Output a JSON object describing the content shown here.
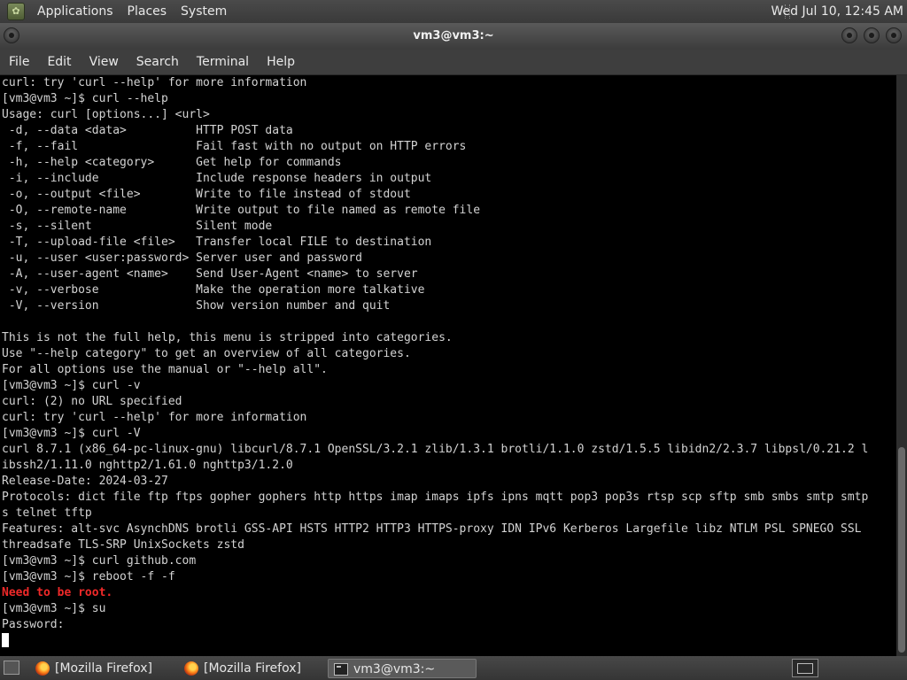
{
  "top_panel": {
    "menus": [
      "Applications",
      "Places",
      "System"
    ],
    "clock": "Wed Jul 10, 12:45 AM"
  },
  "window": {
    "title": "vm3@vm3:~"
  },
  "menubar": [
    "File",
    "Edit",
    "View",
    "Search",
    "Terminal",
    "Help"
  ],
  "terminal": {
    "lines": [
      {
        "text": "curl: try 'curl --help' for more information"
      },
      {
        "text": "[vm3@vm3 ~]$ curl --help"
      },
      {
        "text": "Usage: curl [options...] <url>"
      },
      {
        "text": " -d, --data <data>          HTTP POST data"
      },
      {
        "text": " -f, --fail                 Fail fast with no output on HTTP errors"
      },
      {
        "text": " -h, --help <category>      Get help for commands"
      },
      {
        "text": " -i, --include              Include response headers in output"
      },
      {
        "text": " -o, --output <file>        Write to file instead of stdout"
      },
      {
        "text": " -O, --remote-name          Write output to file named as remote file"
      },
      {
        "text": " -s, --silent               Silent mode"
      },
      {
        "text": " -T, --upload-file <file>   Transfer local FILE to destination"
      },
      {
        "text": " -u, --user <user:password> Server user and password"
      },
      {
        "text": " -A, --user-agent <name>    Send User-Agent <name> to server"
      },
      {
        "text": " -v, --verbose              Make the operation more talkative"
      },
      {
        "text": " -V, --version              Show version number and quit"
      },
      {
        "text": ""
      },
      {
        "text": "This is not the full help, this menu is stripped into categories."
      },
      {
        "text": "Use \"--help category\" to get an overview of all categories."
      },
      {
        "text": "For all options use the manual or \"--help all\"."
      },
      {
        "text": "[vm3@vm3 ~]$ curl -v"
      },
      {
        "text": "curl: (2) no URL specified"
      },
      {
        "text": "curl: try 'curl --help' for more information"
      },
      {
        "text": "[vm3@vm3 ~]$ curl -V"
      },
      {
        "text": "curl 8.7.1 (x86_64-pc-linux-gnu) libcurl/8.7.1 OpenSSL/3.2.1 zlib/1.3.1 brotli/1.1.0 zstd/1.5.5 libidn2/2.3.7 libpsl/0.21.2 l"
      },
      {
        "text": "ibssh2/1.11.0 nghttp2/1.61.0 nghttp3/1.2.0"
      },
      {
        "text": "Release-Date: 2024-03-27"
      },
      {
        "text": "Protocols: dict file ftp ftps gopher gophers http https imap imaps ipfs ipns mqtt pop3 pop3s rtsp scp sftp smb smbs smtp smtp"
      },
      {
        "text": "s telnet tftp"
      },
      {
        "text": "Features: alt-svc AsynchDNS brotli GSS-API HSTS HTTP2 HTTP3 HTTPS-proxy IDN IPv6 Kerberos Largefile libz NTLM PSL SPNEGO SSL"
      },
      {
        "text": "threadsafe TLS-SRP UnixSockets zstd"
      },
      {
        "text": "[vm3@vm3 ~]$ curl github.com"
      },
      {
        "text": "[vm3@vm3 ~]$ reboot -f -f"
      },
      {
        "text": "Need to be root.",
        "color": "#ef2929"
      },
      {
        "text": "[vm3@vm3 ~]$ su"
      },
      {
        "text": "Password:"
      }
    ]
  },
  "taskbar": {
    "items": [
      {
        "label": "[Mozilla Firefox]",
        "icon": "firefox-icon",
        "active": false
      },
      {
        "label": "[Mozilla Firefox]",
        "icon": "firefox-icon",
        "active": false
      },
      {
        "label": "vm3@vm3:~",
        "icon": "terminal-icon",
        "active": true
      }
    ]
  }
}
